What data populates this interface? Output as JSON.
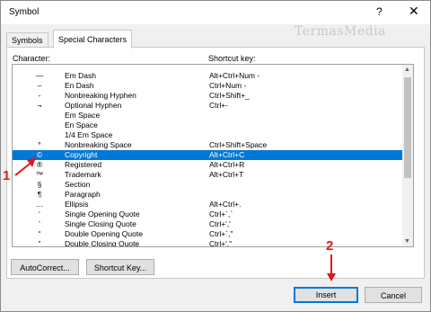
{
  "window": {
    "title": "Symbol"
  },
  "controls": {
    "help": "?",
    "close": "✕"
  },
  "watermark": "TermasMedia",
  "tabs": [
    {
      "label": "Symbols",
      "active": false
    },
    {
      "label": "Special Characters",
      "active": true
    }
  ],
  "list": {
    "col_character": "Character:",
    "col_shortcut": "Shortcut key:",
    "selected_index": 8,
    "rows": [
      {
        "symbol": "—",
        "name": "Em Dash",
        "shortcut": "Alt+Ctrl+Num -"
      },
      {
        "symbol": "–",
        "name": "En Dash",
        "shortcut": "Ctrl+Num -"
      },
      {
        "symbol": "-",
        "name": "Nonbreaking Hyphen",
        "shortcut": "Ctrl+Shift+_"
      },
      {
        "symbol": "¬",
        "name": "Optional Hyphen",
        "shortcut": "Ctrl+-"
      },
      {
        "symbol": "",
        "name": "Em Space",
        "shortcut": ""
      },
      {
        "symbol": "",
        "name": "En Space",
        "shortcut": ""
      },
      {
        "symbol": "",
        "name": "1/4 Em Space",
        "shortcut": ""
      },
      {
        "symbol": "°",
        "name": "Nonbreaking Space",
        "shortcut": "Ctrl+Shift+Space"
      },
      {
        "symbol": "©",
        "name": "Copyright",
        "shortcut": "Alt+Ctrl+C"
      },
      {
        "symbol": "®",
        "name": "Registered",
        "shortcut": "Alt+Ctrl+R"
      },
      {
        "symbol": "™",
        "name": "Trademark",
        "shortcut": "Alt+Ctrl+T"
      },
      {
        "symbol": "§",
        "name": "Section",
        "shortcut": ""
      },
      {
        "symbol": "¶",
        "name": "Paragraph",
        "shortcut": ""
      },
      {
        "symbol": "…",
        "name": "Ellipsis",
        "shortcut": "Alt+Ctrl+."
      },
      {
        "symbol": "‘",
        "name": "Single Opening Quote",
        "shortcut": "Ctrl+`,`"
      },
      {
        "symbol": "’",
        "name": "Single Closing Quote",
        "shortcut": "Ctrl+','"
      },
      {
        "symbol": "“",
        "name": "Double Opening Quote",
        "shortcut": "Ctrl+`,\""
      },
      {
        "symbol": "”",
        "name": "Double Closing Quote",
        "shortcut": "Ctrl+',\""
      }
    ]
  },
  "buttons": {
    "autocorrect": "AutoCorrect...",
    "shortcut_key": "Shortcut Key...",
    "insert": "Insert",
    "cancel": "Cancel"
  },
  "annotations": {
    "step1": "1",
    "step2": "2",
    "color": "#e3141b"
  }
}
